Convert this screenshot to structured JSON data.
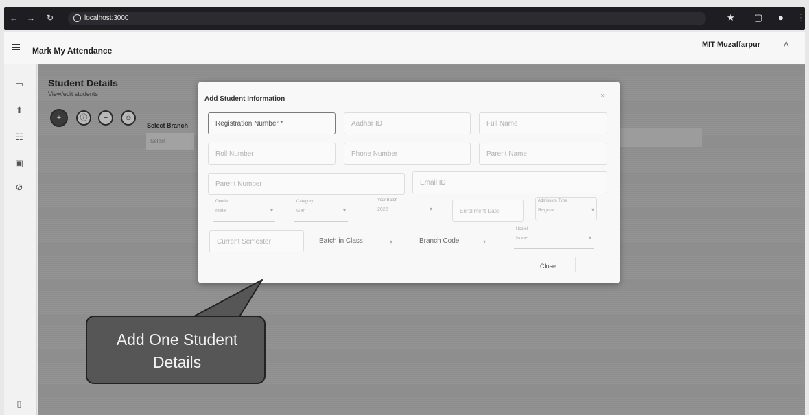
{
  "browser": {
    "url": "localhost:3000",
    "nav_icons": [
      "back-icon",
      "forward-icon",
      "reload-icon"
    ],
    "right_icons": [
      "star-icon",
      "extensions-icon",
      "profile-icon",
      "menu-icon"
    ]
  },
  "app": {
    "title": "Mark My Attendance",
    "college": "MIT Muzaffarpur",
    "avatar_label": "A"
  },
  "sidebar": {
    "items": [
      "calendar-icon",
      "upload-icon",
      "students-icon",
      "id-card-icon",
      "settings-icon"
    ]
  },
  "page": {
    "title": "Student Details",
    "subtitle": "View/edit students",
    "select_branch_label": "Select Branch",
    "select_placeholder": "Select"
  },
  "dialog": {
    "title": "Add Student Information",
    "close_glyph": "×",
    "fields": {
      "registration_number": "Registration Number *",
      "aadhar_id": "Aadhar ID",
      "full_name": "Full Name",
      "roll_number": "Roll Number",
      "phone_number": "Phone Number",
      "parent_name": "Parent Name",
      "parent_number": "Parent Number",
      "email_id": "Email ID",
      "current_semester": "Current Semester",
      "batch_in_class": "Batch in Class",
      "branch_code": "Branch Code"
    },
    "selects": {
      "gender": {
        "label": "Gender",
        "value": "Male"
      },
      "category": {
        "label": "Category",
        "value": "Gen"
      },
      "year_batch": {
        "label": "Year Batch",
        "value": "2022"
      },
      "admission_type": {
        "label": "Admission Type",
        "value": "Regular"
      },
      "hostel": {
        "label": "Hostel",
        "value": "None"
      }
    },
    "enrollment_date": "Enrollment Date",
    "close_label": "Close"
  },
  "callout": {
    "line1": "Add One Student",
    "line2": "Details"
  }
}
